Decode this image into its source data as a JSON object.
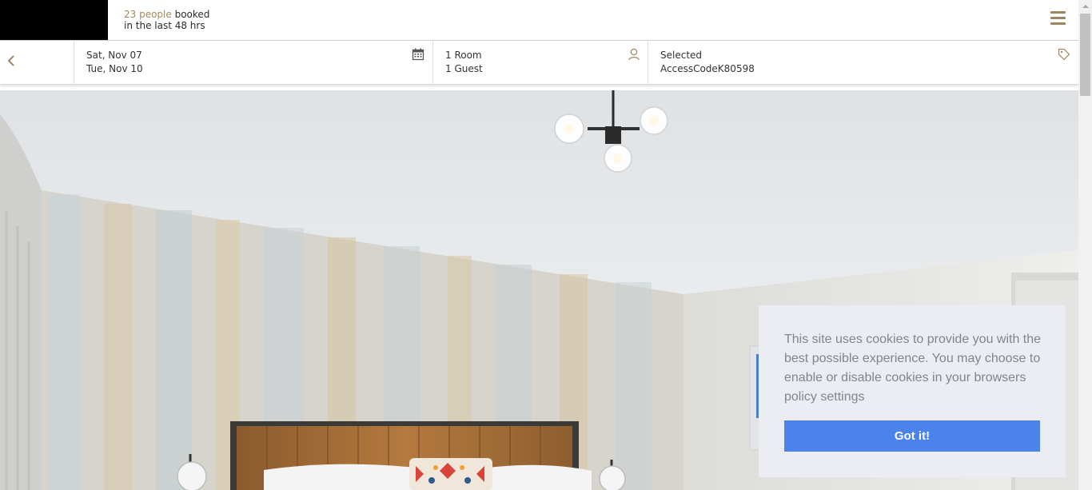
{
  "header": {
    "social_proof": {
      "count": "23 people",
      "suffix": " booked",
      "line2": "in the last 48 hrs"
    },
    "menu_icon": "hamburger-menu-icon"
  },
  "booking": {
    "back_icon": "chevron-left-icon",
    "dates": {
      "check_in": "Sat, Nov 07",
      "check_out": "Tue, Nov 10",
      "icon": "calendar-icon"
    },
    "guests": {
      "rooms": "1 Room",
      "guests": "1 Guest",
      "icon": "person-icon"
    },
    "rate": {
      "label": "Selected",
      "code": "AccessCodeK80598",
      "icon": "tag-icon"
    }
  },
  "cookie_banner": {
    "message": "This site uses cookies to provide you with the best possible experience. You may choose to enable or disable cookies in your browsers policy settings",
    "button_label": "Got it!"
  },
  "colors": {
    "accent_gold": "#9e8760",
    "cookie_button": "#4c83ea",
    "cookie_bg": "#ebedf3"
  }
}
